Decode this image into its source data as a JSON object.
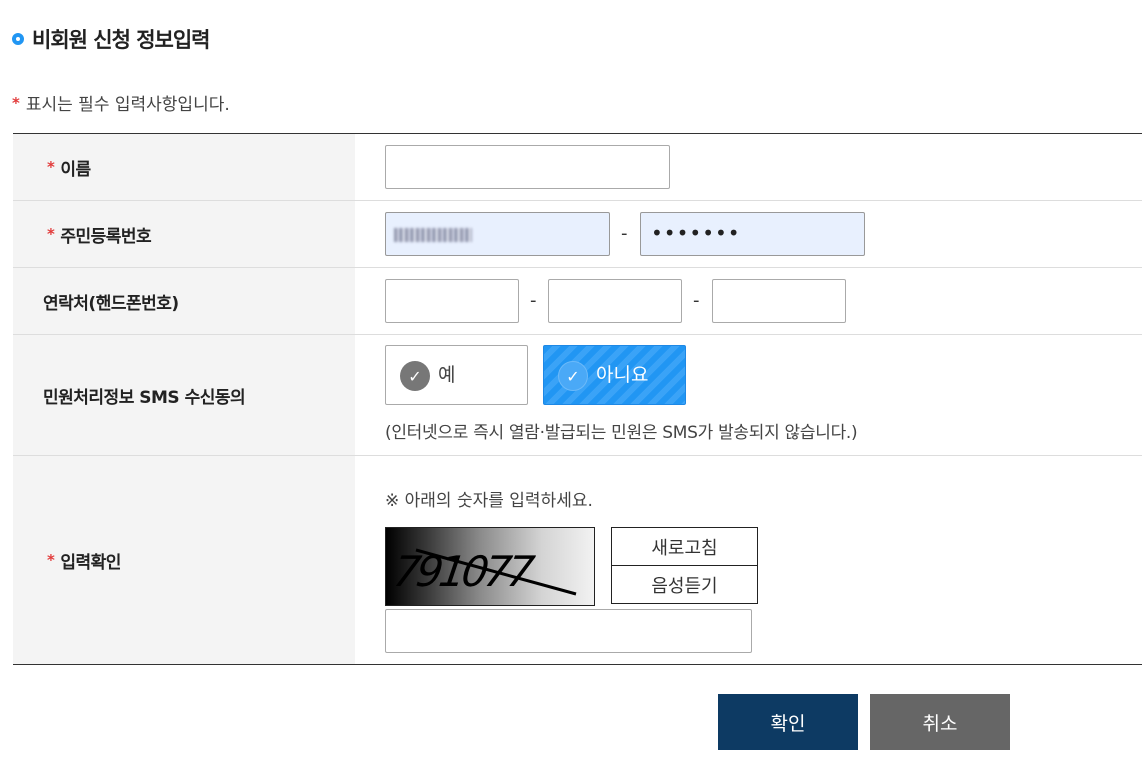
{
  "page": {
    "title": "비회원 신청 정보입력",
    "required_note": "표시는 필수 입력사항입니다.",
    "required_mark": "*"
  },
  "form": {
    "name": {
      "label": "이름",
      "value": "",
      "required": true
    },
    "resident_number": {
      "label": "주민등록번호",
      "front_value": "",
      "back_value": "•••••••",
      "separator": "-",
      "required": true
    },
    "phone": {
      "label": "연락처(핸드폰번호)",
      "part1": "",
      "part2": "",
      "part3": "",
      "separator": "-",
      "required": false
    },
    "sms_consent": {
      "label": "민원처리정보 SMS 수신동의",
      "option_yes": "예",
      "option_no": "아니요",
      "selected": "아니요",
      "note": "(인터넷으로 즉시 열람·발급되는 민원은 SMS가 발송되지 않습니다.)"
    },
    "captcha": {
      "label": "입력확인",
      "instruction": "※ 아래의 숫자를 입력하세요.",
      "image_text": "791077",
      "refresh_label": "새로고침",
      "audio_label": "음성듣기",
      "value": "",
      "required": true
    }
  },
  "actions": {
    "confirm_label": "확인",
    "cancel_label": "취소"
  },
  "colors": {
    "accent": "#2196f3",
    "required": "#e23b3b",
    "confirm_bg": "#0d3a63",
    "cancel_bg": "#666666",
    "selected_option": "#2196f3"
  }
}
